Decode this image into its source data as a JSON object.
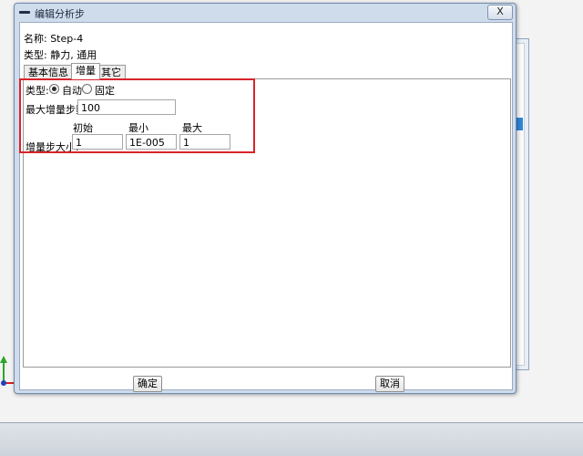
{
  "dialog": {
    "title": "编辑分析步",
    "close_label": "X",
    "name_label": "名称: Step-4",
    "type_label": "类型: 静力, 通用"
  },
  "tabs": [
    {
      "label": "基本信息",
      "active": false
    },
    {
      "label": "增量",
      "active": true
    },
    {
      "label": "其它",
      "active": false
    }
  ],
  "increment": {
    "type_label": "类型:",
    "options": [
      {
        "label": "自动",
        "selected": true
      },
      {
        "label": "固定",
        "selected": false
      }
    ],
    "max_steps_label": "最大增量步数:",
    "max_steps_value": "100",
    "col_initial": "初始",
    "col_min": "最小",
    "col_max": "最大",
    "size_label": "增量步大小:",
    "initial_value": "1",
    "min_value": "1E-005",
    "max_value": "1"
  },
  "buttons": {
    "ok_label": "确定",
    "cancel_label": "取消"
  },
  "colors": {
    "highlight": "#d8242b",
    "titlebar": "#cfdcec"
  }
}
